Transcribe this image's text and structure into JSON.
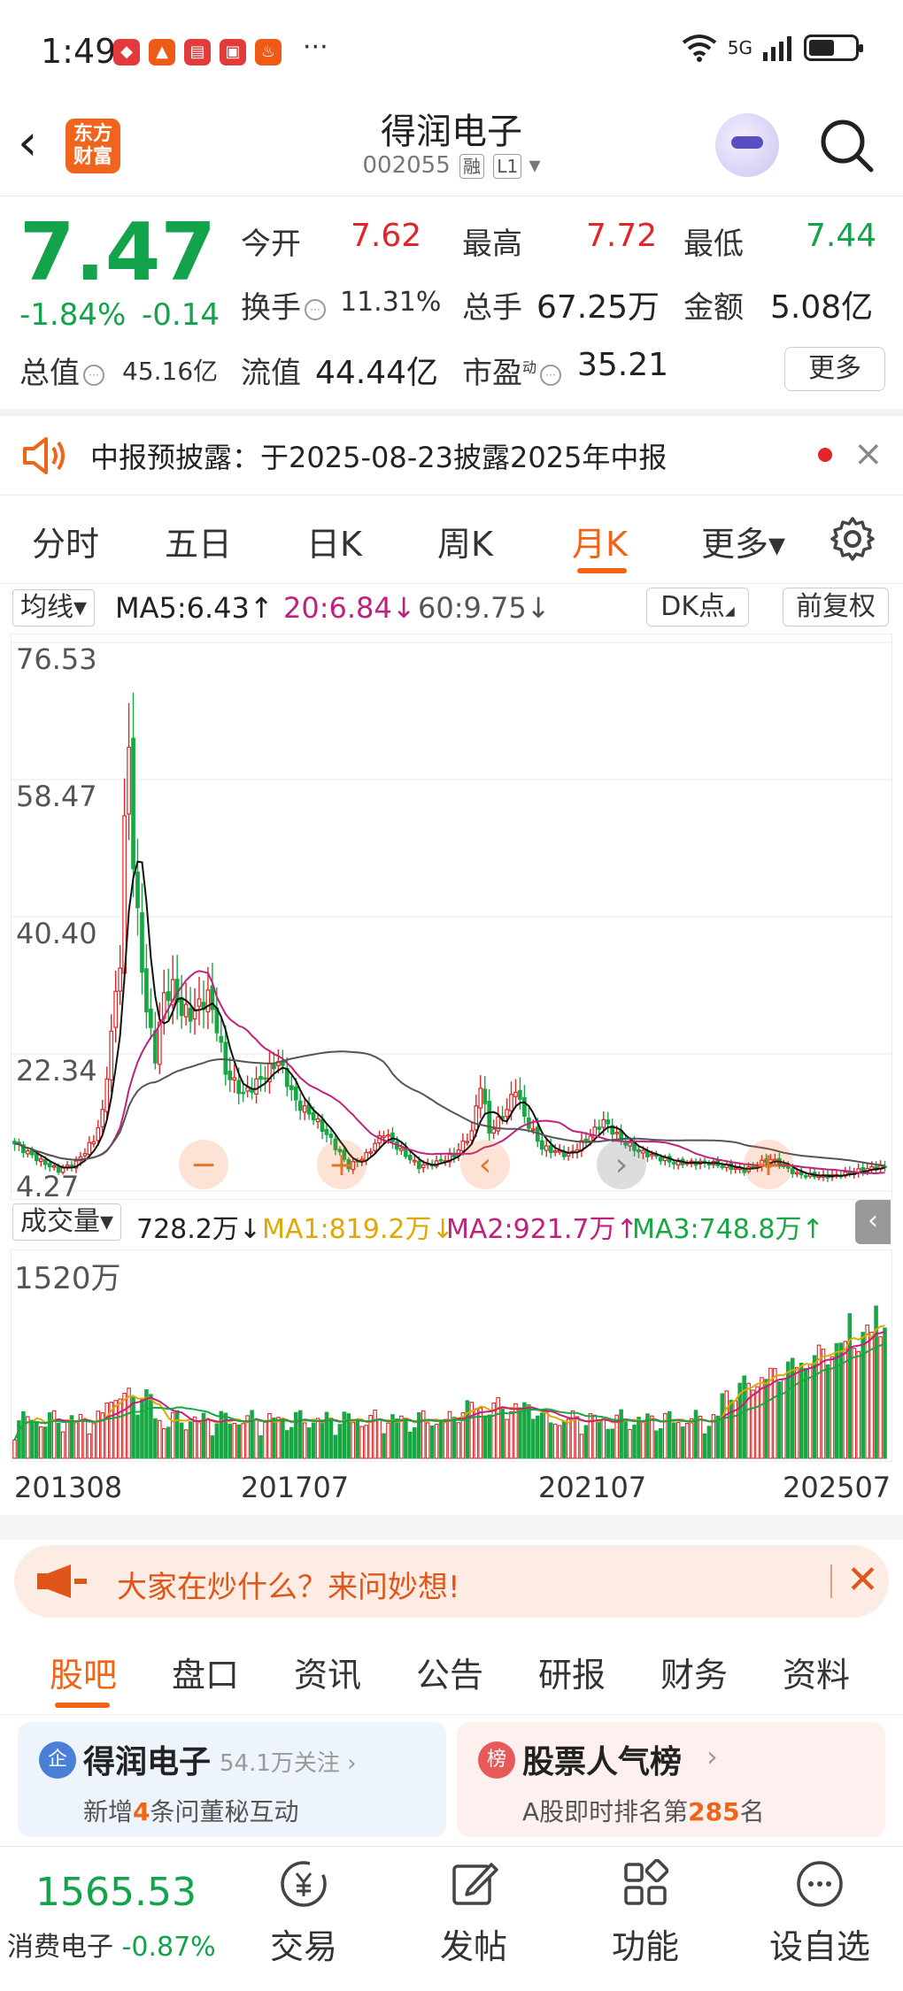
{
  "status": {
    "time": "1:49",
    "dots": "···",
    "network": "5G",
    "battery_level": 0.55
  },
  "header": {
    "logo_line1": "东方",
    "logo_line2": "财富",
    "stock_name": "得润电子",
    "stock_code": "002055",
    "tag_margin": "融",
    "tag_level": "L1",
    "back_glyph": "‹"
  },
  "quote": {
    "price": "7.47",
    "change_pct": "-1.84%",
    "change_amt": "-0.14",
    "open_label": "今开",
    "open": "7.62",
    "high_label": "最高",
    "high": "7.72",
    "low_label": "最低",
    "low": "7.44",
    "turnover_label": "换手",
    "turnover": "11.31%",
    "volume_label": "总手",
    "volume": "67.25万",
    "amount_label": "金额",
    "amount": "5.08亿",
    "total_mv_label": "总值",
    "total_mv": "45.16亿",
    "float_mv_label": "流值",
    "float_mv": "44.44亿",
    "pe_label": "市盈",
    "pe_sup": "动",
    "pe": "35.21",
    "more_button": "更多"
  },
  "notice": {
    "text": "中报预披露：于2025-08-23披露2025年中报",
    "close": "×"
  },
  "tabs": [
    {
      "label": "分时"
    },
    {
      "label": "五日"
    },
    {
      "label": "日K"
    },
    {
      "label": "周K"
    },
    {
      "label": "月K"
    },
    {
      "label": "更多▾"
    }
  ],
  "ma_bar": {
    "select": "均线▾",
    "ma5": "MA5:6.43↑",
    "ma20": "20:6.84↓",
    "ma60": "60:9.75↓",
    "dk_button": "DK点",
    "adjust_button": "前复权"
  },
  "volume_bar": {
    "select": "成交量▾",
    "vol": "728.2万↓",
    "ma1": "MA1:819.2万↓",
    "ma2": "MA2:921.7万↑",
    "ma3": "MA3:748.8万↑",
    "axis_label": "1520万"
  },
  "chart_data": {
    "type": "candlestick",
    "title": "",
    "y_ticks": [
      "76.53",
      "58.47",
      "40.40",
      "22.34",
      "4.27"
    ],
    "ylim": [
      4.27,
      76.53
    ],
    "x_ticks": [
      "201308",
      "201707",
      "202107",
      "202507"
    ],
    "ma_series": [
      {
        "name": "MA5",
        "color": "#111111"
      },
      {
        "name": "MA20",
        "color": "#c0217e"
      },
      {
        "name": "MA60",
        "color": "#555555"
      }
    ],
    "colors": {
      "up": "#d92626",
      "down": "#17a843"
    },
    "keypoints_close": [
      [
        0,
        10.5
      ],
      [
        6,
        8.2
      ],
      [
        10,
        7.0
      ],
      [
        14,
        8.0
      ],
      [
        18,
        11.0
      ],
      [
        20,
        14.5
      ],
      [
        22,
        25.0
      ],
      [
        24,
        35.0
      ],
      [
        25,
        52.0
      ],
      [
        26,
        63.0
      ],
      [
        27,
        48.0
      ],
      [
        28,
        40.0
      ],
      [
        30,
        28.0
      ],
      [
        32,
        22.0
      ],
      [
        34,
        30.0
      ],
      [
        36,
        31.0
      ],
      [
        38,
        28.0
      ],
      [
        40,
        27.5
      ],
      [
        44,
        30.0
      ],
      [
        46,
        26.0
      ],
      [
        48,
        20.0
      ],
      [
        52,
        17.0
      ],
      [
        56,
        19.0
      ],
      [
        60,
        21.5
      ],
      [
        64,
        16.0
      ],
      [
        68,
        14.0
      ],
      [
        72,
        11.0
      ],
      [
        76,
        7.5
      ],
      [
        80,
        9.0
      ],
      [
        84,
        12.0
      ],
      [
        88,
        9.5
      ],
      [
        92,
        7.5
      ],
      [
        96,
        8.0
      ],
      [
        100,
        9.0
      ],
      [
        104,
        12.0
      ],
      [
        106,
        18.5
      ],
      [
        108,
        12.0
      ],
      [
        112,
        15.0
      ],
      [
        114,
        18.0
      ],
      [
        116,
        14.0
      ],
      [
        120,
        10.0
      ],
      [
        126,
        9.0
      ],
      [
        130,
        11.0
      ],
      [
        134,
        13.5
      ],
      [
        138,
        11.0
      ],
      [
        142,
        9.5
      ],
      [
        150,
        8.0
      ],
      [
        158,
        8.0
      ],
      [
        166,
        7.0
      ],
      [
        172,
        8.5
      ],
      [
        178,
        6.5
      ],
      [
        184,
        6.2
      ],
      [
        188,
        6.4
      ],
      [
        194,
        7.2
      ],
      [
        198,
        7.47
      ]
    ]
  },
  "banner": {
    "text": "大家在炒什么？来问妙想!",
    "close": "✕"
  },
  "bottom_tabs": [
    {
      "label": "股吧"
    },
    {
      "label": "盘口"
    },
    {
      "label": "资讯"
    },
    {
      "label": "公告"
    },
    {
      "label": "研报"
    },
    {
      "label": "财务"
    },
    {
      "label": "资料"
    }
  ],
  "cards": {
    "left": {
      "icon": "企",
      "title": "得润电子",
      "follow": "54.1万关注 ›",
      "desc_prefix": "新增",
      "desc_num": "4",
      "desc_suffix": "条问董秘互动"
    },
    "right": {
      "icon": "榜",
      "title": "股票人气榜",
      "arrow": "›",
      "desc_prefix": "A股即时排名第",
      "desc_num": "285",
      "desc_suffix": "名"
    }
  },
  "bottom_bar": {
    "index_value": "1565.53",
    "index_name": "消费电子",
    "index_change": "-0.87%",
    "items": [
      {
        "label": "交易",
        "icon": "yuan-icon"
      },
      {
        "label": "发帖",
        "icon": "edit-icon"
      },
      {
        "label": "功能",
        "icon": "grid-icon"
      },
      {
        "label": "设自选",
        "icon": "more-icon"
      }
    ]
  }
}
